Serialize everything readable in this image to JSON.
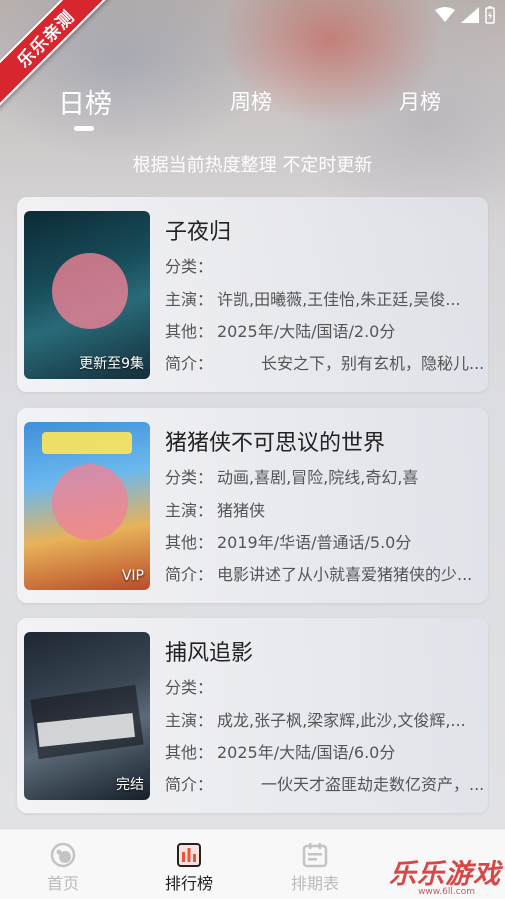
{
  "status_bar": {
    "icons": [
      "wifi-icon",
      "signal-icon",
      "battery-icon"
    ]
  },
  "ribbon": {
    "text": "乐乐亲测"
  },
  "tabs": [
    {
      "label": "日榜",
      "active": true
    },
    {
      "label": "周榜",
      "active": false
    },
    {
      "label": "月榜",
      "active": false
    }
  ],
  "subtitle": "根据当前热度整理 不定时更新",
  "cards": [
    {
      "title": "子夜归",
      "badge": "更新至9集",
      "category_label": "分类：",
      "category": "",
      "cast_label": "主演：",
      "cast": "许凯,田曦薇,王佳怡,朱正廷,吴俊...",
      "other_label": "其他：",
      "other": "2025年/大陆/国语/2.0分",
      "intro_label": "简介：",
      "intro": "长安之下，别有玄机，隐秘儿..."
    },
    {
      "title": "猪猪侠不可思议的世界",
      "badge": "VIP",
      "category_label": "分类：",
      "category": "动画,喜剧,冒险,院线,奇幻,喜",
      "cast_label": "主演：",
      "cast": "猪猪侠",
      "other_label": "其他：",
      "other": "2019年/华语/普通话/5.0分",
      "intro_label": "简介：",
      "intro": "电影讲述了从小就喜爱猪猪侠的少..."
    },
    {
      "title": "捕风追影",
      "badge": "完结",
      "category_label": "分类：",
      "category": "",
      "cast_label": "主演：",
      "cast": "成龙,张子枫,梁家辉,此沙,文俊辉,...",
      "other_label": "其他：",
      "other": "2025年/大陆/国语/6.0分",
      "intro_label": "简介：",
      "intro": "一伙天才盗匪劫走数亿资产，..."
    }
  ],
  "bottom_nav": [
    {
      "label": "首页",
      "icon": "home-icon",
      "active": false
    },
    {
      "label": "排行榜",
      "icon": "ranking-icon",
      "active": true
    },
    {
      "label": "排期表",
      "icon": "calendar-icon",
      "active": false
    }
  ],
  "watermark": {
    "text": "乐乐游戏",
    "sub": "www.6ll.com"
  }
}
